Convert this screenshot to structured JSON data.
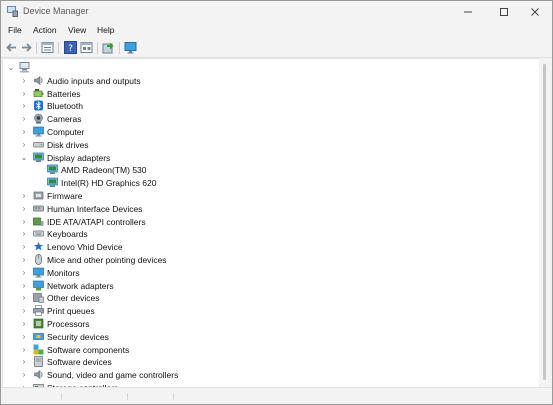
{
  "window": {
    "title": "Device Manager"
  },
  "menu": {
    "items": [
      "File",
      "Action",
      "View",
      "Help"
    ]
  },
  "toolbar": {
    "buttons": [
      "back-arrow",
      "forward-arrow",
      "properties",
      "help",
      "show-hidden",
      "update-driver",
      "monitor"
    ]
  },
  "tree": {
    "root_icon": "computer-root-icon",
    "items": [
      {
        "label": "Audio inputs and outputs",
        "icon": "speaker-icon"
      },
      {
        "label": "Batteries",
        "icon": "battery-icon"
      },
      {
        "label": "Bluetooth",
        "icon": "bluetooth-icon"
      },
      {
        "label": "Cameras",
        "icon": "camera-icon"
      },
      {
        "label": "Computer",
        "icon": "computer-icon"
      },
      {
        "label": "Disk drives",
        "icon": "disk-icon"
      },
      {
        "label": "Display adapters",
        "icon": "display-icon",
        "expanded": true,
        "children": [
          {
            "label": "AMD Radeon(TM) 530"
          },
          {
            "label": "Intel(R) HD Graphics 620"
          }
        ]
      },
      {
        "label": "Firmware",
        "icon": "firmware-icon"
      },
      {
        "label": "Human Interface Devices",
        "icon": "hid-icon"
      },
      {
        "label": "IDE ATA/ATAPI controllers",
        "icon": "ide-icon"
      },
      {
        "label": "Keyboards",
        "icon": "keyboard-icon"
      },
      {
        "label": "Lenovo Vhid Device",
        "icon": "hid-device-icon"
      },
      {
        "label": "Mice and other pointing devices",
        "icon": "mouse-icon"
      },
      {
        "label": "Monitors",
        "icon": "monitor-icon"
      },
      {
        "label": "Network adapters",
        "icon": "network-icon"
      },
      {
        "label": "Other devices",
        "icon": "other-device-icon"
      },
      {
        "label": "Print queues",
        "icon": "printer-icon"
      },
      {
        "label": "Processors",
        "icon": "processor-icon"
      },
      {
        "label": "Security devices",
        "icon": "security-icon"
      },
      {
        "label": "Software components",
        "icon": "software-component-icon"
      },
      {
        "label": "Software devices",
        "icon": "software-device-icon"
      },
      {
        "label": "Sound, video and game controllers",
        "icon": "sound-icon"
      },
      {
        "label": "Storage controllers",
        "icon": "storage-icon"
      }
    ]
  }
}
